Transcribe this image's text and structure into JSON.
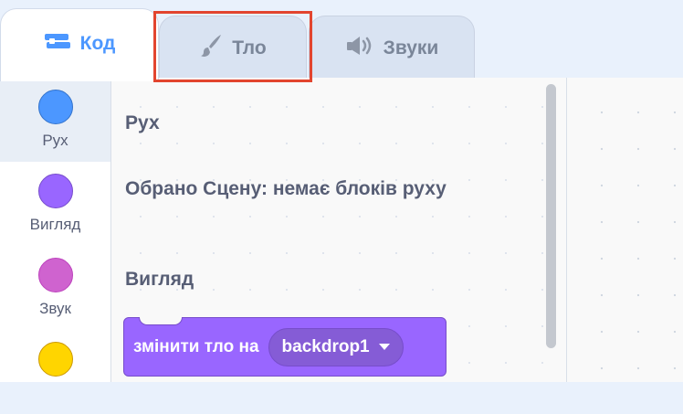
{
  "tabs": {
    "code": "Код",
    "backdrop": "Тло",
    "sounds": "Звуки"
  },
  "categories": [
    {
      "label": "Рух",
      "color": "#4c97ff",
      "border": "#3373cc",
      "selected": true
    },
    {
      "label": "Вигляд",
      "color": "#9966ff",
      "border": "#774dcb",
      "selected": false
    },
    {
      "label": "Звук",
      "color": "#cf63cf",
      "border": "#bd42bd",
      "selected": false
    },
    {
      "label": "",
      "color": "#ffd500",
      "border": "#cc9900",
      "selected": false
    }
  ],
  "palette": {
    "motion_heading": "Рух",
    "motion_note": "Обрано Сцену: немає блоків руху",
    "looks_heading": "Вигляд",
    "block": {
      "text": "змінити тло на",
      "dropdown_value": "backdrop1"
    }
  },
  "colors": {
    "accent": "#4c97ff",
    "looks": "#9966ff",
    "highlight": "#e2452f"
  }
}
